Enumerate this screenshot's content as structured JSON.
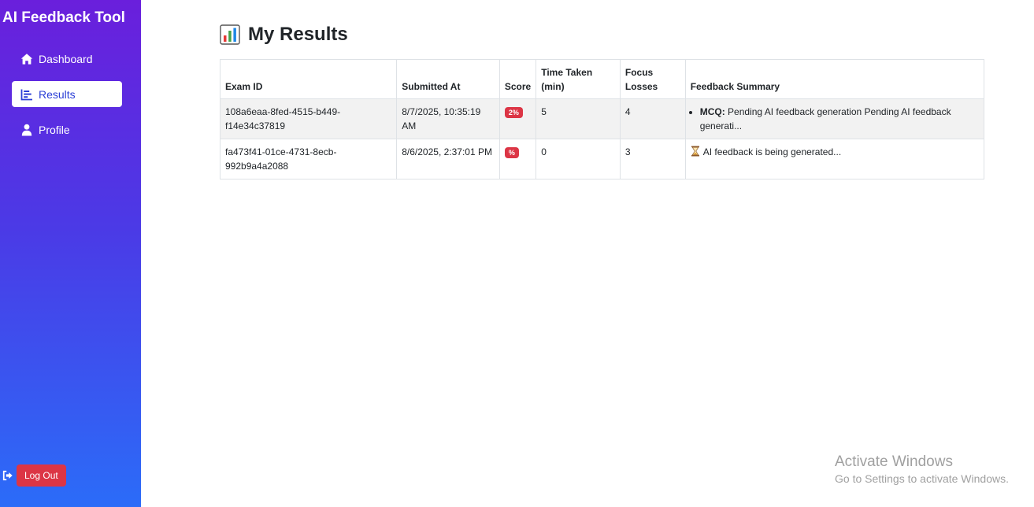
{
  "app": {
    "title": "AI Feedback Tool"
  },
  "sidebar": {
    "items": [
      {
        "label": "Dashboard",
        "icon": "home-icon",
        "active": false
      },
      {
        "label": "Results",
        "icon": "bar-chart-icon",
        "active": true
      },
      {
        "label": "Profile",
        "icon": "user-icon",
        "active": false
      }
    ],
    "logout_label": "Log Out"
  },
  "page": {
    "title": "My Results",
    "title_icon": "bar-chart-emoji-icon"
  },
  "table": {
    "headers": [
      "Exam ID",
      "Submitted At",
      "Score",
      "Time Taken (min)",
      "Focus Losses",
      "Feedback Summary"
    ],
    "rows": [
      {
        "exam_id": "108a6eaa-8fed-4515-b449-f14e34c37819",
        "submitted_at": "8/7/2025, 10:35:19 AM",
        "score": "2%",
        "time_taken": "5",
        "focus_losses": "4",
        "feedback_key": "MCQ:",
        "feedback_text": "Pending AI feedback generation Pending AI feedback generati..."
      },
      {
        "exam_id": "fa473f41-01ce-4731-8ecb-992b9a4a2088",
        "submitted_at": "8/6/2025, 2:37:01 PM",
        "score": "%",
        "time_taken": "0",
        "focus_losses": "3",
        "feedback_text": "AI feedback is being generated..."
      }
    ]
  },
  "watermark": {
    "title": "Activate Windows",
    "subtitle": "Go to Settings to activate Windows."
  },
  "colors": {
    "sidebar_top": "#6a1fdc",
    "sidebar_bottom": "#2b6cf8",
    "danger": "#dc3545",
    "active_text": "#2b3fd6"
  }
}
